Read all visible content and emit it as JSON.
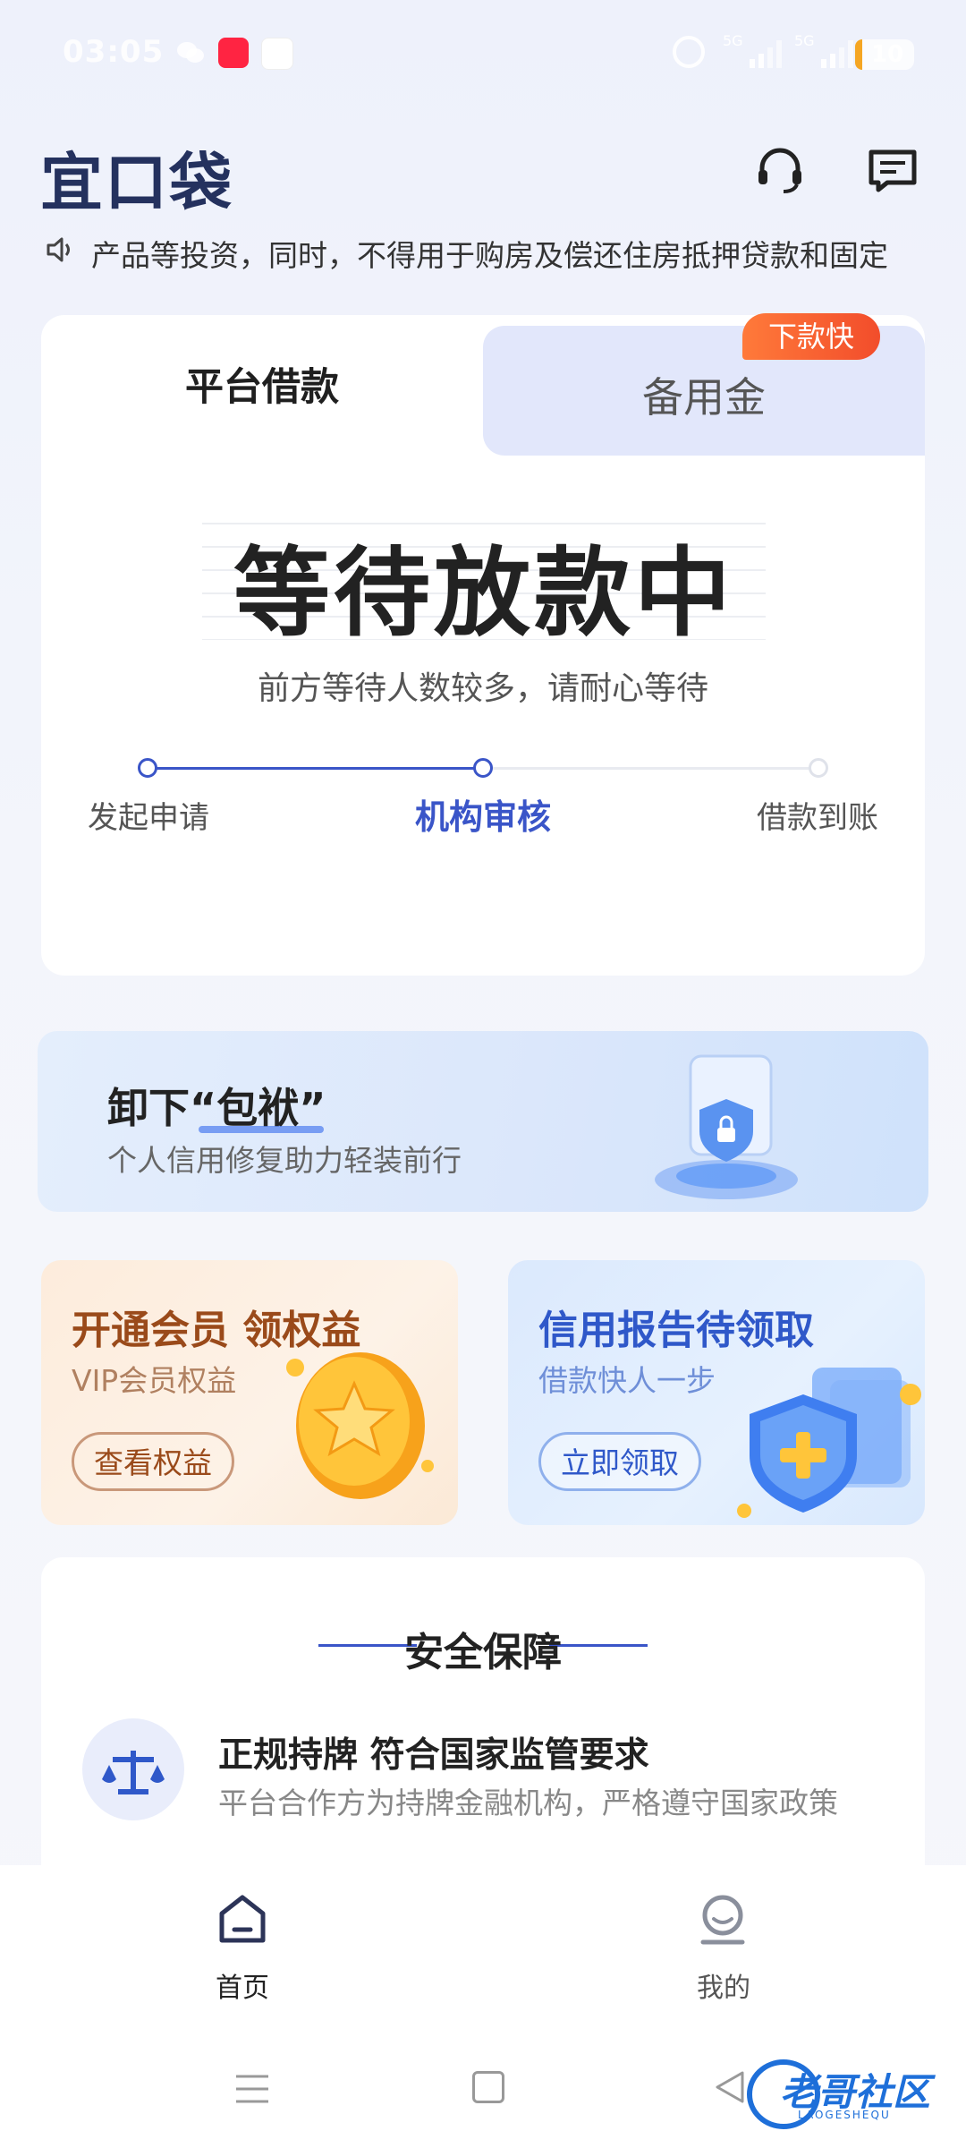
{
  "status_bar": {
    "time": "03:05",
    "battery": "10",
    "net1": "5G",
    "net2": "5G",
    "app_icons": [
      "wechat-icon",
      "xiaohongshu-icon",
      "china-unicom-icon"
    ]
  },
  "header": {
    "logo": "宜口袋",
    "icons": [
      "headset-icon",
      "message-icon"
    ]
  },
  "notice": {
    "text": "产品等投资，同时，不得用于购房及偿还住房抵押贷款和固定"
  },
  "loan_card": {
    "tabs": [
      {
        "label": "平台借款",
        "active": true
      },
      {
        "label": "备用金",
        "active": false
      }
    ],
    "badge": "下款快",
    "status_title": "等待放款中",
    "status_sub": "前方等待人数较多，请耐心等待",
    "steps": [
      {
        "label": "发起申请",
        "done": true
      },
      {
        "label": "机构审核",
        "current": true
      },
      {
        "label": "借款到账",
        "done": false
      }
    ]
  },
  "banner": {
    "title": "卸下“包袱”",
    "subtitle": "个人信用修复助力轻装前行"
  },
  "promos": [
    {
      "title": "开通会员 领权益",
      "subtitle": "VIP会员权益",
      "button": "查看权益"
    },
    {
      "title": "信用报告待领取",
      "subtitle": "借款快人一步",
      "button": "立即领取"
    }
  ],
  "security": {
    "title": "安全保障",
    "item_title": "正规持牌 符合国家监管要求",
    "item_sub": "平台合作方为持牌金融机构，严格遵守国家政策"
  },
  "tabbar": {
    "items": [
      {
        "label": "首页",
        "active": true
      },
      {
        "label": "我的",
        "active": false
      }
    ]
  },
  "watermark": {
    "text": "老哥社区",
    "sub": "LAOGESHEQU"
  },
  "colors": {
    "accent": "#3a55c8",
    "badge": "#f24d2b",
    "vip": "#9a4a1a",
    "credit": "#2f58c9"
  }
}
